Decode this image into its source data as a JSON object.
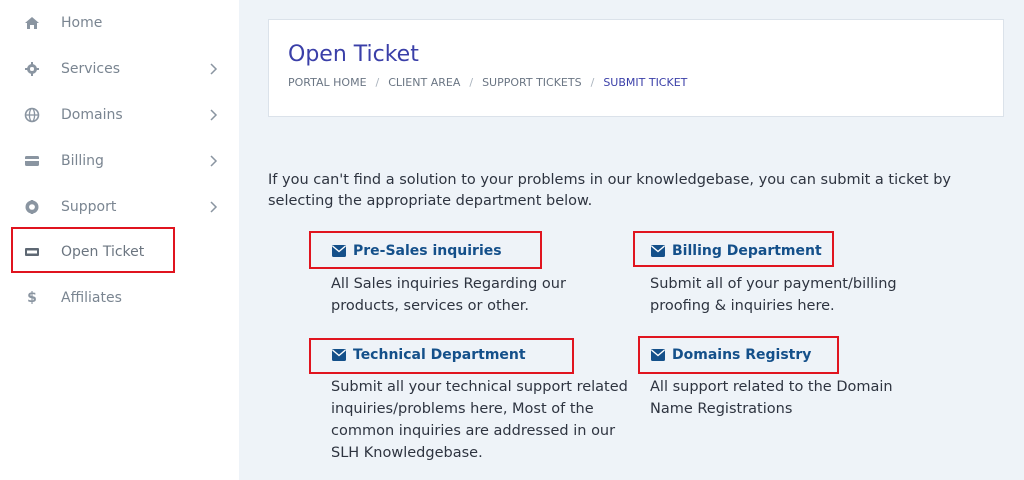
{
  "sidebar": {
    "items": [
      {
        "label": "Home",
        "icon": "home-icon",
        "has_chevron": false
      },
      {
        "label": "Services",
        "icon": "gear-icon",
        "has_chevron": true
      },
      {
        "label": "Domains",
        "icon": "globe-icon",
        "has_chevron": true
      },
      {
        "label": "Billing",
        "icon": "credit-card-icon",
        "has_chevron": true
      },
      {
        "label": "Support",
        "icon": "lifebuoy-icon",
        "has_chevron": true
      },
      {
        "label": "Open Ticket",
        "icon": "ticket-icon",
        "has_chevron": false,
        "highlighted": true
      },
      {
        "label": "Affiliates",
        "icon": "dollar-icon",
        "has_chevron": false
      }
    ]
  },
  "header": {
    "title": "Open Ticket",
    "breadcrumb": [
      "PORTAL HOME",
      "CLIENT AREA",
      "SUPPORT TICKETS",
      "SUBMIT TICKET"
    ]
  },
  "intro_text": "If you can't find a solution to your problems in our knowledgebase, you can submit a ticket by selecting the appropriate department below.",
  "departments": [
    {
      "name": "Pre-Sales inquiries",
      "icon": "envelope-icon",
      "description": "All Sales inquiries Regarding our products, services or other."
    },
    {
      "name": "Billing Department",
      "icon": "envelope-icon",
      "description": "Submit all of your payment/billing proofing & inquiries here."
    },
    {
      "name": "Technical Department",
      "icon": "envelope-icon",
      "description": "Submit all your technical support related inquiries/problems here, Most of the common inquiries are addressed in our SLH Knowledgebase."
    },
    {
      "name": "Domains Registry",
      "icon": "envelope-icon",
      "description": "All support related to the Domain Name Registrations"
    }
  ],
  "colors": {
    "highlight": "#e0141f",
    "accent": "#3a3fa8",
    "link": "#14508a",
    "background": "#eef3f8"
  }
}
